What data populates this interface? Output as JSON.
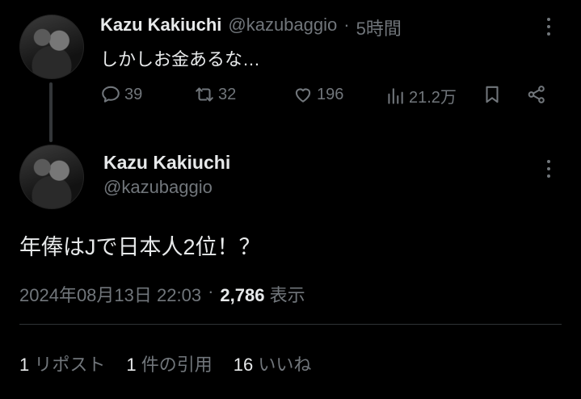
{
  "reply_tweet": {
    "display_name": "Kazu Kakiuchi",
    "handle": "@kazubaggio",
    "separator": "·",
    "time_ago": "5時間",
    "text": "しかしお金あるな…",
    "actions": {
      "replies": "39",
      "retweets": "32",
      "likes": "196",
      "views": "21.2万"
    }
  },
  "main_tweet": {
    "display_name": "Kazu Kakiuchi",
    "handle": "@kazubaggio",
    "text": "年俸はJで日本人2位！？",
    "timestamp": "2024年08月13日 22:03",
    "separator": "·",
    "view_count": "2,786",
    "view_label": "表示",
    "stats": {
      "reposts_count": "1",
      "reposts_label": "リポスト",
      "quotes_count": "1",
      "quotes_label": "件の引用",
      "likes_count": "16",
      "likes_label": "いいね"
    }
  },
  "icons": [
    "reply-icon",
    "retweet-icon",
    "like-icon",
    "views-icon",
    "bookmark-icon",
    "share-icon",
    "more-options-icon"
  ]
}
